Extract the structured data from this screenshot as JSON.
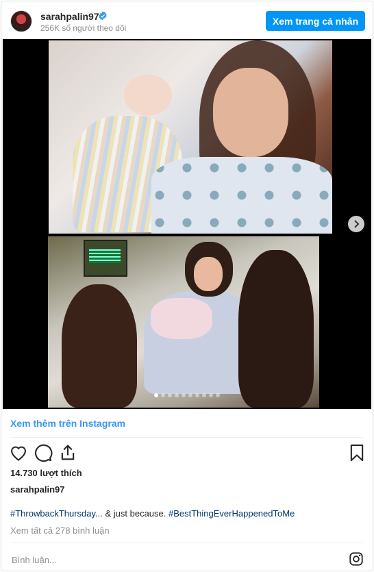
{
  "header": {
    "username": "sarahpalin97",
    "followers": "256K số người theo dõi",
    "profile_button": "Xem trang cá nhân",
    "verified_icon": "verified-badge-icon",
    "accent_color": "#0095f6"
  },
  "carousel": {
    "photo_count": 10,
    "current_index": 1,
    "next_icon": "chevron-right-icon"
  },
  "more_link": "Xem thêm trên Instagram",
  "actions": {
    "like_icon": "heart-icon",
    "comment_icon": "comment-icon",
    "share_icon": "share-icon",
    "save_icon": "bookmark-icon"
  },
  "likes": "14.730 lượt thích",
  "caption": {
    "username": "sarahpalin97",
    "tag1": "#ThrowbackThursday",
    "middle": "... & just because. ",
    "tag2": "#BestThingEverHappenedToMe"
  },
  "view_comments": "Xem tất cả 278 bình luận",
  "comment_placeholder": "Bình luận...",
  "footer_icon": "instagram-icon"
}
